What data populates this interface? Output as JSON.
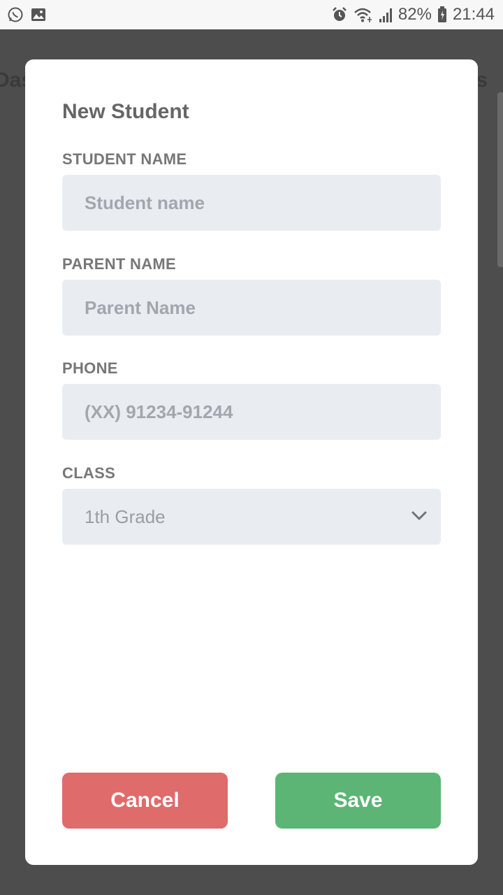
{
  "status_bar": {
    "battery": "82%",
    "time": "21:44",
    "left_icons": [
      "whatsapp-icon",
      "image-icon"
    ],
    "right_icons": [
      "alarm-icon",
      "wifi-icon",
      "signal-icon",
      "battery-icon"
    ]
  },
  "background": {
    "title_left": "Das",
    "title_right": "s"
  },
  "modal": {
    "title": "New Student",
    "fields": [
      {
        "label": "STUDENT NAME",
        "placeholder": "Student name",
        "value": ""
      },
      {
        "label": "PARENT NAME",
        "placeholder": "Parent Name",
        "value": ""
      },
      {
        "label": "PHONE",
        "placeholder": "(XX) 91234-91244",
        "value": ""
      }
    ],
    "class_field": {
      "label": "CLASS",
      "selected": "1th Grade",
      "icon": "chevron-down-icon"
    },
    "buttons": {
      "cancel": "Cancel",
      "save": "Save"
    }
  },
  "colors": {
    "overlay": "#4d4d4d",
    "input_bg": "#e9edf2",
    "cancel": "#df6b6b",
    "save": "#5cb574"
  }
}
